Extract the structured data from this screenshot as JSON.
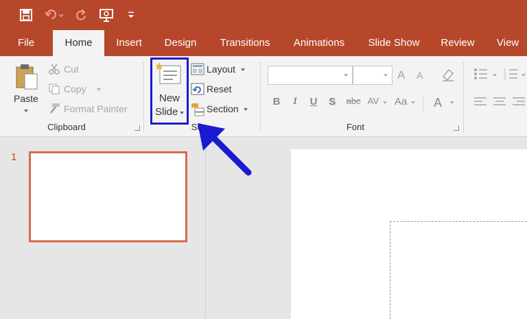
{
  "quick_access": {
    "icons": [
      "save-icon",
      "undo-icon",
      "redo-icon",
      "start-from-beginning-icon",
      "customize-qat-icon"
    ]
  },
  "tabs": [
    {
      "label": "File",
      "active": false
    },
    {
      "label": "Home",
      "active": true
    },
    {
      "label": "Insert",
      "active": false
    },
    {
      "label": "Design",
      "active": false
    },
    {
      "label": "Transitions",
      "active": false
    },
    {
      "label": "Animations",
      "active": false
    },
    {
      "label": "Slide Show",
      "active": false
    },
    {
      "label": "Review",
      "active": false
    },
    {
      "label": "View",
      "active": false
    }
  ],
  "ribbon": {
    "clipboard": {
      "group_label": "Clipboard",
      "paste_label": "Paste",
      "cut_label": "Cut",
      "copy_label": "Copy",
      "format_painter_label": "Format Painter"
    },
    "slides": {
      "group_label": "Sli",
      "new_slide_label_1": "New",
      "new_slide_label_2": "Slide",
      "layout_label": "Layout",
      "reset_label": "Reset",
      "section_label": "Section"
    },
    "font": {
      "group_label": "Font",
      "font_name_value": "",
      "font_size_value": "",
      "grow_label": "A",
      "shrink_label": "A",
      "bold_label": "B",
      "italic_label": "I",
      "underline_label": "U",
      "shadow_label": "S",
      "strike_label": "abc",
      "spacing_label": "AV",
      "case_label": "Aa",
      "color_label": "A"
    }
  },
  "thumbnails": [
    {
      "number": "1"
    }
  ],
  "colors": {
    "accent": "#b7472a",
    "highlight": "#1a1ad0",
    "thumb_border": "#d9694a"
  }
}
